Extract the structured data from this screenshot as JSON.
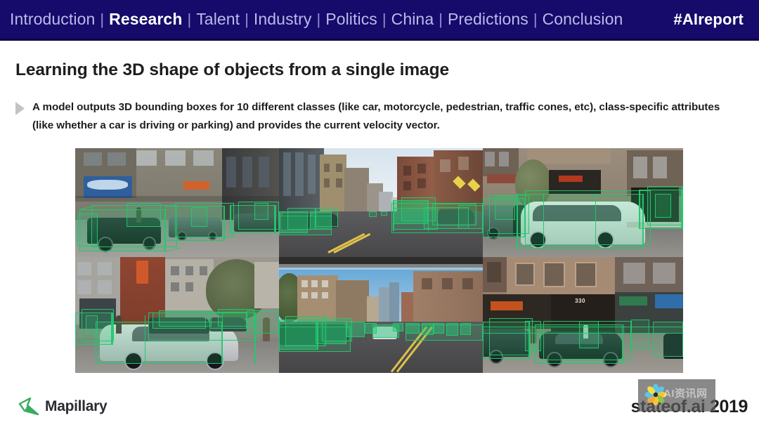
{
  "navbar": {
    "separator": "|",
    "items": [
      {
        "label": "Introduction",
        "active": false
      },
      {
        "label": "Research",
        "active": true
      },
      {
        "label": "Talent",
        "active": false
      },
      {
        "label": "Industry",
        "active": false
      },
      {
        "label": "Politics",
        "active": false
      },
      {
        "label": "China",
        "active": false
      },
      {
        "label": "Predictions",
        "active": false
      },
      {
        "label": "Conclusion",
        "active": false
      }
    ],
    "hashtag": "#AIreport",
    "background_color": "#160a6b",
    "link_color": "#b9bbe8",
    "active_color": "#ffffff"
  },
  "slide": {
    "title": "Learning the 3D shape of objects from a single image",
    "bullet": "A model outputs 3D bounding boxes for 10 different classes (like car, motorcycle, pedestrian, traffic cones, etc), class-specific attributes (like whether a car is driving or parking) and provides the current velocity vector.",
    "bullet_marker": "triangle-right-icon"
  },
  "figure": {
    "name": "3d-bounding-box-examples-grid",
    "bbox_color": "#22c86e",
    "photos": [
      {
        "id": "photo-1",
        "caption": "Street with parked dark cars beside storefronts"
      },
      {
        "id": "photo-2",
        "caption": "Narrow street corridor looking toward skyline"
      },
      {
        "id": "photo-3",
        "caption": "White minivan parked in front of brown building"
      },
      {
        "id": "photo-4",
        "caption": "Silver sedan parked with pedestrian on sidewalk"
      },
      {
        "id": "photo-5",
        "caption": "Wide avenue with traffic and bike racks"
      },
      {
        "id": "photo-6",
        "caption": "Dark sedans parked in front of building number 330"
      }
    ],
    "address_label": "330"
  },
  "footer": {
    "logo_mark": "mapillary-arrow-icon",
    "logo_text": "Mapillary",
    "brand": "stateof.ai 2019",
    "logo_color": "#3aab62"
  },
  "watermark": {
    "text": "AI资讯网",
    "icon": "flower-logo-icon"
  }
}
